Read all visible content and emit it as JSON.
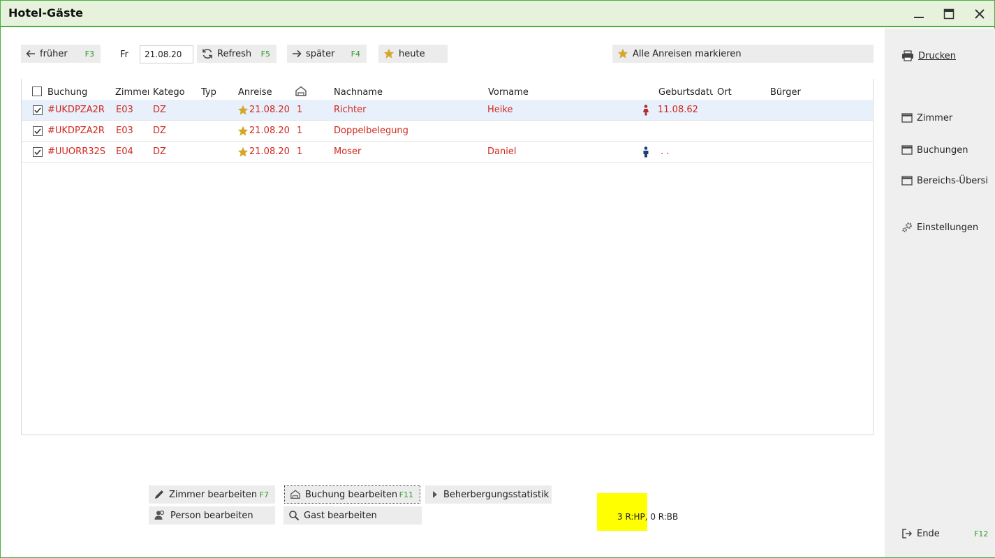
{
  "window": {
    "title": "Hotel-Gäste"
  },
  "toolbar": {
    "prev_label": "früher",
    "prev_key": "F3",
    "day_label": "Fr",
    "date_value": "21.08.20",
    "refresh_label": "Refresh",
    "refresh_key": "F5",
    "next_label": "später",
    "next_key": "F4",
    "today_label": "heute",
    "mark_all_label": "Alle Anreisen markieren"
  },
  "table": {
    "headers": {
      "buchung": "Buchung",
      "zimmer": "Zimmer",
      "kategorie": "Kategoı",
      "typ": "Typ",
      "anreise": "Anreise",
      "nachname": "Nachname",
      "vorname": "Vorname",
      "geburtsdatum": "Geburtsdatu",
      "ort": "Ort",
      "buerger": "Bürger"
    },
    "rows": [
      {
        "buchung": "#UKDPZA2R",
        "zimmer": "E03",
        "kategorie": "DZ",
        "anreise": "21.08.20",
        "count": "1",
        "nachname": "Richter",
        "vorname": "Heike",
        "gender": "female",
        "geburtsdatum": "11.08.62",
        "checked": true
      },
      {
        "buchung": "#UKDPZA2R",
        "zimmer": "E03",
        "kategorie": "DZ",
        "anreise": "21.08.20",
        "count": "1",
        "nachname": "Doppelbelegung",
        "vorname": "",
        "gender": "",
        "geburtsdatum": "",
        "checked": true
      },
      {
        "buchung": "#UUORR32S",
        "zimmer": "E04",
        "kategorie": "DZ",
        "anreise": "21.08.20",
        "count": "1",
        "nachname": "Moser",
        "vorname": "Daniel",
        "gender": "male",
        "geburtsdatum": ". .",
        "checked": true
      }
    ]
  },
  "sidebar": {
    "print_label": "Drucken",
    "zimmer_label": "Zimmer",
    "buchungen_label": "Buchungen",
    "bereich_label": "Bereichs-Übersi",
    "settings_label": "Einstellungen",
    "end_label": "Ende",
    "end_key": "F12"
  },
  "bottom": {
    "edit_room_label": "Zimmer bearbeiten",
    "edit_room_key": "F7",
    "edit_booking_label": "Buchung bearbeiten",
    "edit_booking_key": "F11",
    "stats_label": "Beherbergungsstatistik",
    "edit_person_label": "Person bearbeiten",
    "edit_guest_label": "Gast bearbeiten"
  },
  "status": {
    "text": "3 R:HP, 0 R:BB",
    "highlight_color": "#ffff00"
  },
  "colors": {
    "accent": "#4caf3f",
    "row_text": "#d0281e",
    "key_text": "#2a9a2a",
    "star": "#d4a72c",
    "female": "#b03030",
    "male": "#1f3f7a"
  }
}
